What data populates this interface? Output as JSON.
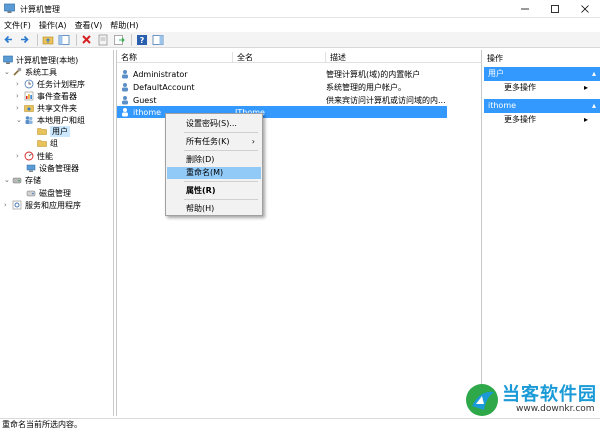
{
  "window": {
    "title": "计算机管理"
  },
  "menubar": [
    "文件(F)",
    "操作(A)",
    "查看(V)",
    "帮助(H)"
  ],
  "tree": {
    "root": "计算机管理(本地)",
    "system_tools": "系统工具",
    "task_scheduler": "任务计划程序",
    "event_viewer": "事件查看器",
    "shared_folders": "共享文件夹",
    "local_users": "本地用户和组",
    "users": "用户",
    "groups": "组",
    "performance": "性能",
    "device_manager": "设备管理器",
    "storage": "存储",
    "disk_management": "磁盘管理",
    "services_apps": "服务和应用程序"
  },
  "list": {
    "columns": [
      "名称",
      "全名",
      "描述"
    ],
    "rows": [
      {
        "name": "Administrator",
        "fullname": "",
        "description": "管理计算机(域)的内置帐户"
      },
      {
        "name": "DefaultAccount",
        "fullname": "",
        "description": "系统管理的用户帐户。"
      },
      {
        "name": "Guest",
        "fullname": "",
        "description": "供来宾访问计算机或访问域的内..."
      },
      {
        "name": "ithome",
        "fullname": "IThome",
        "description": ""
      }
    ]
  },
  "actions": {
    "header": "操作",
    "section1": "用户",
    "section1_more": "更多操作",
    "section2": "ithome",
    "section2_more": "更多操作"
  },
  "context_menu": {
    "items": [
      "设置密码(S)...",
      "所有任务(K)",
      "删除(D)",
      "重命名(M)",
      "属性(R)",
      "帮助(H)"
    ]
  },
  "status": "重命名当前所选内容。",
  "watermark": {
    "text": "当客软件园",
    "url": "www.downkr.com"
  },
  "colors": {
    "selection": "#3399ff",
    "menu_highlight": "#91c9f7",
    "tree_selection": "#cce8ff"
  }
}
